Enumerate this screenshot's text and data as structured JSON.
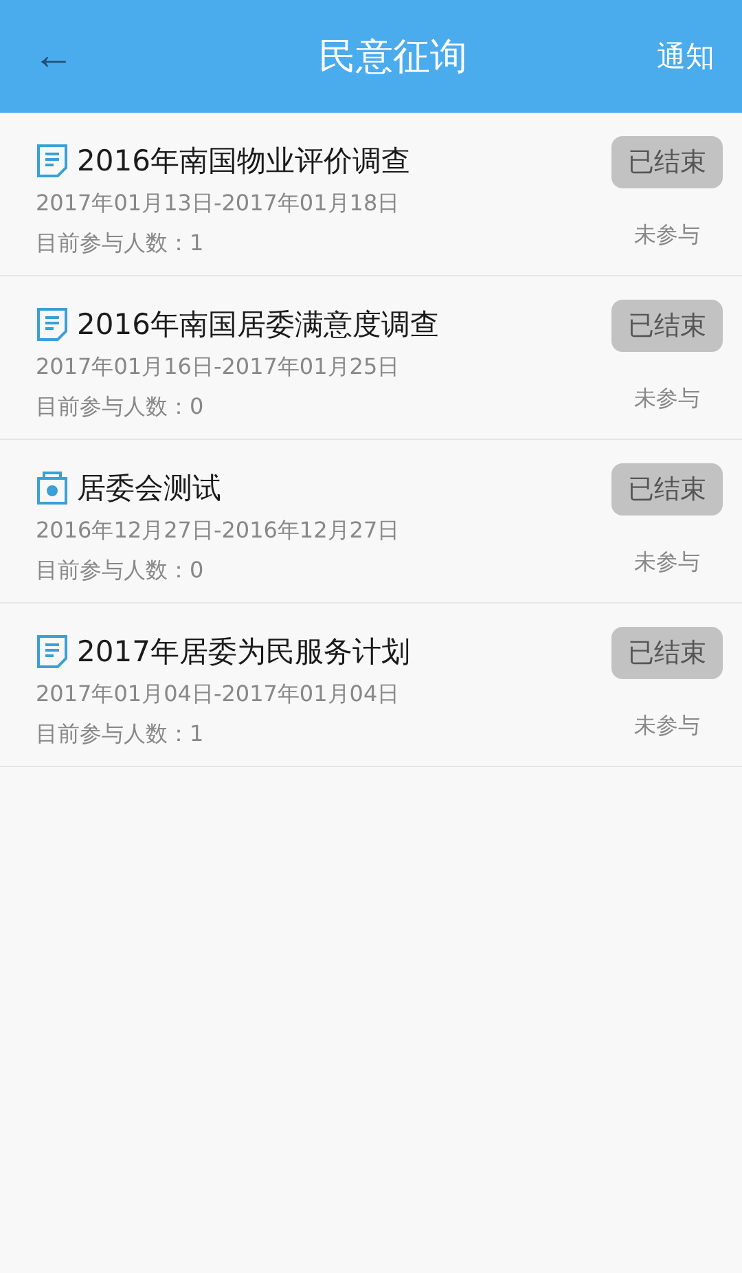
{
  "header": {
    "back": "←",
    "title": "民意征询",
    "action": "通知"
  },
  "surveys": [
    {
      "kind": "document",
      "title": "2016年南国物业评价调查",
      "dates": "2017年01月13日-2017年01月18日",
      "participants": "目前参与人数：1",
      "status": "已结束",
      "participation": "未参与"
    },
    {
      "kind": "document",
      "title": "2016年南国居委满意度调查",
      "dates": "2017年01月16日-2017年01月25日",
      "participants": "目前参与人数：0",
      "status": "已结束",
      "participation": "未参与"
    },
    {
      "kind": "vote",
      "title": "居委会测试",
      "dates": "2016年12月27日-2016年12月27日",
      "participants": "目前参与人数：0",
      "status": "已结束",
      "participation": "未参与"
    },
    {
      "kind": "document",
      "title": "2017年居委为民服务计划",
      "dates": "2017年01月04日-2017年01月04日",
      "participants": "目前参与人数：1",
      "status": "已结束",
      "participation": "未参与"
    }
  ]
}
